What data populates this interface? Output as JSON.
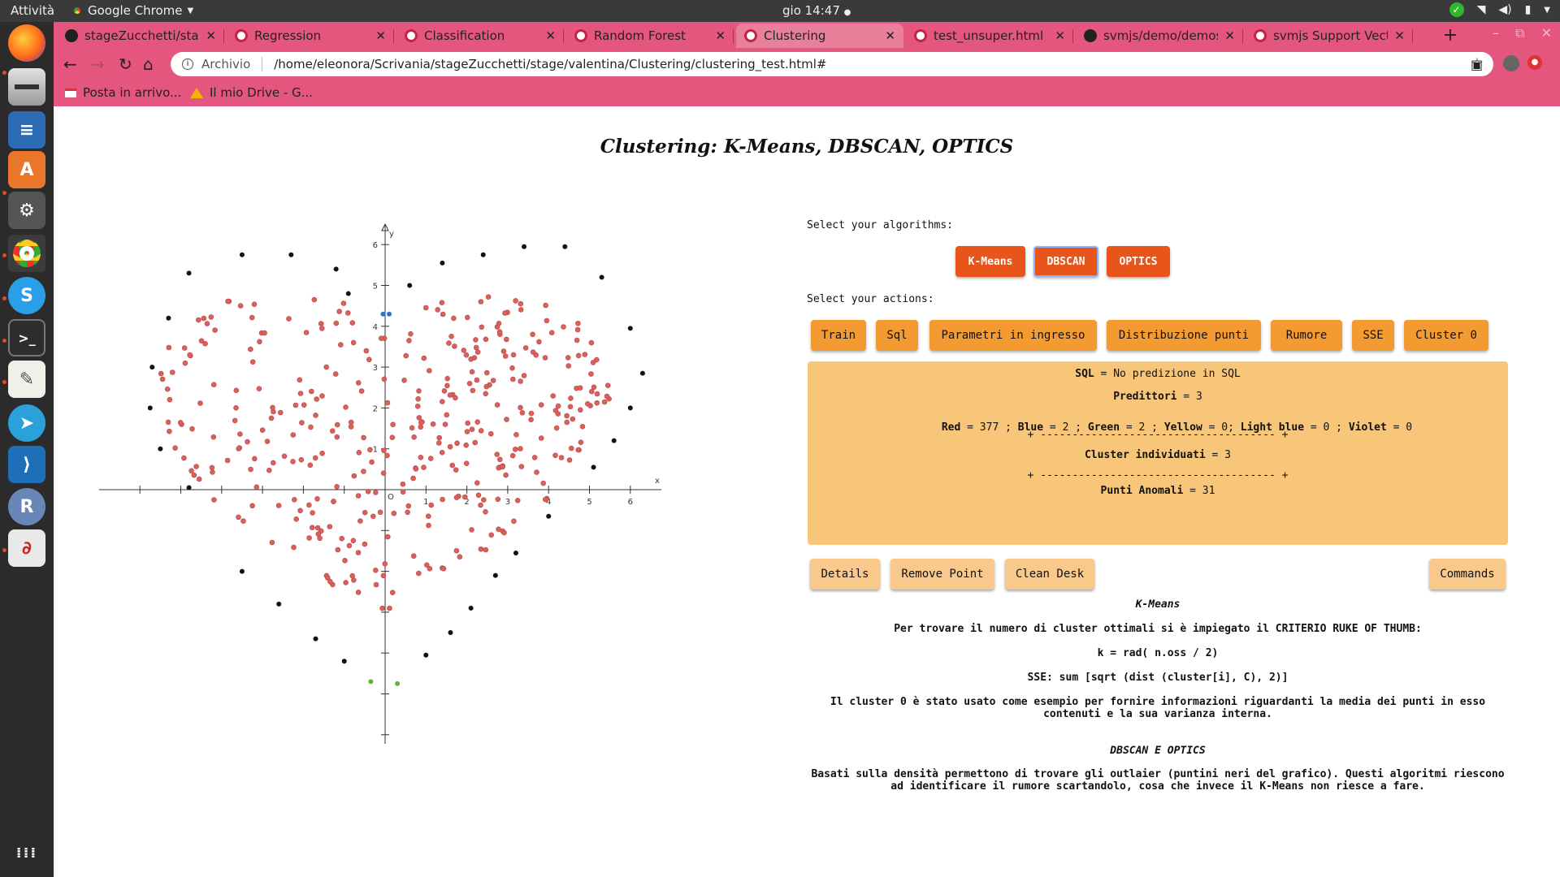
{
  "os": {
    "activities": "Attività",
    "app_name": "Google Chrome",
    "clock": "gio 14:47"
  },
  "browser": {
    "tabs": [
      {
        "label": "stageZucchetti/stage",
        "favicon": "github-icon"
      },
      {
        "label": "Regression",
        "favicon": "chrome-icon"
      },
      {
        "label": "Classification",
        "favicon": "chrome-icon"
      },
      {
        "label": "Random Forest",
        "favicon": "chrome-icon"
      },
      {
        "label": "Clustering",
        "favicon": "chrome-icon",
        "active": true
      },
      {
        "label": "test_unsuper.html",
        "favicon": "chrome-icon"
      },
      {
        "label": "svmjs/demo/demosv",
        "favicon": "github-icon"
      },
      {
        "label": "svmjs Support Vecto",
        "favicon": "chrome-icon"
      }
    ],
    "address_label": "Archivio",
    "url": "/home/eleonora/Scrivania/stageZucchetti/stage/valentina/Clustering/clustering_test.html#",
    "bookmarks": [
      "Posta in arrivo...",
      "Il mio Drive - G..."
    ]
  },
  "page": {
    "title": "Clustering: K-Means, DBSCAN, OPTICS",
    "select_algorithms": "Select your algorithms:",
    "algorithms": [
      "K-Means",
      "DBSCAN",
      "OPTICS"
    ],
    "selected_algorithm": "DBSCAN",
    "select_actions": "Select your actions:",
    "actions": [
      "Train",
      "Sql",
      "Parametri in ingresso",
      "Distribuzione punti",
      "Rumore",
      "SSE",
      "Cluster 0"
    ],
    "info": {
      "sql_label": "SQL",
      "sql_value": " = No predizione in SQL",
      "predittori_label": "Predittori",
      "predittori_value": " = 3",
      "counts_line": [
        {
          "label": "Red",
          "value": " = 377 ; "
        },
        {
          "label": "Blue",
          "value": " = 2 ; "
        },
        {
          "label": "Green",
          "value": " = 2 ; "
        },
        {
          "label": "Yellow",
          "value": " = 0; "
        },
        {
          "label": "Light blue",
          "value": " = 0 ; "
        },
        {
          "label": "Violet",
          "value": " = 0"
        }
      ],
      "separator": "+ ------------------------------------- +",
      "cluster_label": "Cluster individuati",
      "cluster_value": " = 3",
      "anom_label": "Punti Anomali",
      "anom_value": " = 31"
    },
    "bottom_buttons": [
      "Details",
      "Remove Point",
      "Clean Desk"
    ],
    "commands_button": "Commands",
    "desc": {
      "kmeans_title": "K-Means",
      "kmeans_line1": "Per trovare il numero di cluster ottimali si è impiegato il CRITERIO RUKE OF THUMB:",
      "kmeans_formula": "k = rad( n.oss / 2)",
      "sse_formula": "SSE: sum [sqrt (dist (cluster[i], C), 2)]",
      "cluster0_text": "Il cluster 0 è stato usato come esempio per fornire informazioni riguardanti la media dei punti in esso contenuti e la sua varianza interna.",
      "dbscan_title": "DBSCAN E OPTICS",
      "dbscan_text": "Basati sulla densità permettono di trovare gli outlaier (puntini neri del grafico). Questi algoritmi riescono ad identificare il rumore scartandolo, cosa che invece il K-Means non riesce a fare."
    }
  },
  "chart_data": {
    "type": "scatter",
    "xlabel": "x",
    "ylabel": "y",
    "origin_label": "O",
    "xlim": [
      -7,
      7
    ],
    "ylim": [
      -6.5,
      6.5
    ],
    "x_ticks": [
      1,
      2,
      3,
      4,
      5,
      6
    ],
    "y_ticks": [
      1,
      2,
      3,
      4,
      5,
      6
    ],
    "colors": {
      "red": "#d9605c",
      "blue": "#2f6fd6",
      "green": "#5fb43a",
      "noise": "#111111"
    },
    "series": [
      {
        "name": "Red",
        "count": 377,
        "shape": "heart"
      },
      {
        "name": "Blue",
        "values": [
          [
            -0.05,
            4.3
          ],
          [
            0.1,
            4.3
          ]
        ]
      },
      {
        "name": "Green",
        "values": [
          [
            -0.35,
            -4.7
          ],
          [
            0.3,
            -4.75
          ]
        ]
      },
      {
        "name": "Noise",
        "values": [
          [
            -4.8,
            5.3
          ],
          [
            -3.5,
            5.75
          ],
          [
            -2.3,
            5.75
          ],
          [
            -1.2,
            5.4
          ],
          [
            1.4,
            5.55
          ],
          [
            2.4,
            5.75
          ],
          [
            3.4,
            5.95
          ],
          [
            4.4,
            5.95
          ],
          [
            5.3,
            5.2
          ],
          [
            6.0,
            3.95
          ],
          [
            6.3,
            2.85
          ],
          [
            6.0,
            2.0
          ],
          [
            5.6,
            1.2
          ],
          [
            5.1,
            0.55
          ],
          [
            4.0,
            -0.65
          ],
          [
            3.2,
            -1.55
          ],
          [
            2.7,
            -2.1
          ],
          [
            2.1,
            -2.9
          ],
          [
            1.6,
            -3.5
          ],
          [
            1.0,
            -4.05
          ],
          [
            -1.7,
            -3.65
          ],
          [
            -2.6,
            -2.8
          ],
          [
            -3.5,
            -2.0
          ],
          [
            -4.8,
            0.05
          ],
          [
            -5.5,
            1.0
          ],
          [
            -5.75,
            2.0
          ],
          [
            -5.7,
            3.0
          ],
          [
            -5.3,
            4.2
          ],
          [
            -1.0,
            -4.2
          ],
          [
            0.6,
            5.0
          ],
          [
            -0.9,
            4.8
          ]
        ]
      }
    ]
  }
}
